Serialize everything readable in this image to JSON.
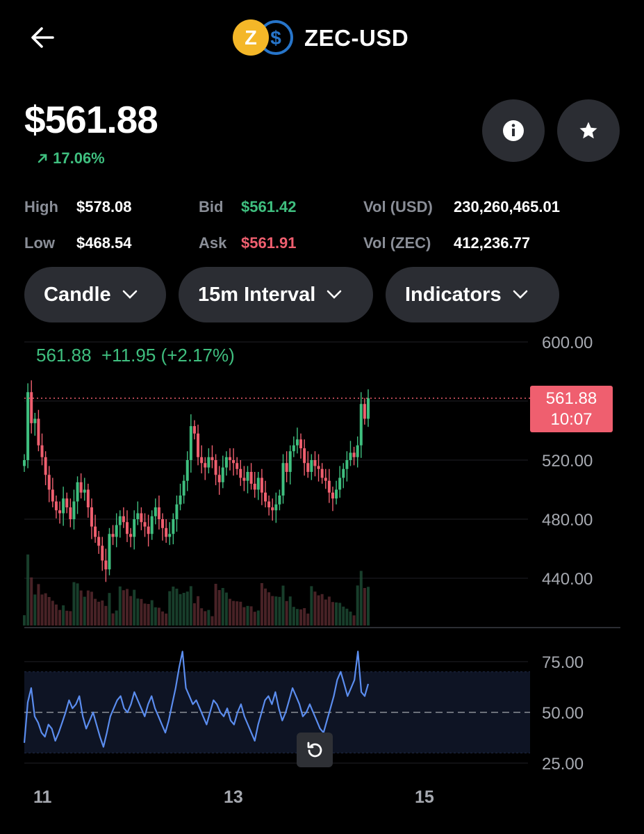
{
  "header": {
    "pair": "ZEC-USD",
    "back_icon": "arrow-left-icon",
    "base_logo_letter": "Z",
    "quote_logo_letter": "$",
    "base_logo_color": "#f4b728",
    "quote_logo_color": "#2775ca"
  },
  "price": {
    "current": "$561.88",
    "change_pct": "17.06%",
    "change_icon": "arrow-up-right-icon"
  },
  "stats": {
    "high_label": "High",
    "high_value": "$578.08",
    "low_label": "Low",
    "low_value": "$468.54",
    "bid_label": "Bid",
    "bid_value": "$561.42",
    "ask_label": "Ask",
    "ask_value": "$561.91",
    "vol_usd_label": "Vol (USD)",
    "vol_usd_value": "230,260,465.01",
    "vol_zec_label": "Vol (ZEC)",
    "vol_zec_value": "412,236.77"
  },
  "controls": {
    "chart_type": "Candle",
    "interval": "15m Interval",
    "indicators": "Indicators"
  },
  "chart": {
    "ohlc_price": "561.88",
    "ohlc_change": "+11.95",
    "ohlc_change_pct": "(+2.17%)",
    "price_tag_value": "561.88",
    "price_tag_countdown": "10:07",
    "price_ticks": [
      "600.00",
      "520.00",
      "480.00",
      "440.00"
    ],
    "rsi_ticks": [
      "75.00",
      "50.00",
      "25.00"
    ],
    "x_ticks": [
      "11",
      "13",
      "15"
    ]
  },
  "colors": {
    "up": "#3fbf7f",
    "down": "#ef5f6f",
    "rsi": "#5b8def",
    "background": "#000000",
    "button": "#2b2d33"
  },
  "chart_data": {
    "type": "candlestick",
    "ylim": [
      420,
      610
    ],
    "close_series": [
      520,
      566,
      545,
      548,
      530,
      522,
      510,
      500,
      492,
      486,
      484,
      494,
      488,
      480,
      492,
      505,
      498,
      500,
      488,
      475,
      468,
      462,
      452,
      446,
      470,
      468,
      476,
      482,
      478,
      470,
      468,
      480,
      484,
      478,
      475,
      470,
      482,
      488,
      480,
      474,
      468,
      470,
      480,
      490,
      496,
      506,
      520,
      543,
      538,
      522,
      518,
      515,
      522,
      520,
      510,
      505,
      515,
      522,
      520,
      518,
      514,
      508,
      506,
      512,
      504,
      500,
      508,
      498,
      492,
      488,
      486,
      490,
      496,
      518,
      512,
      526,
      530,
      534,
      528,
      518,
      512,
      520,
      516,
      514,
      508,
      506,
      498,
      494,
      500,
      508,
      514,
      520,
      525,
      522,
      530,
      558,
      548,
      561.88
    ],
    "rsi_ylim": [
      20,
      90
    ],
    "rsi_series": [
      35,
      55,
      62,
      48,
      45,
      40,
      38,
      44,
      42,
      36,
      40,
      45,
      50,
      56,
      52,
      54,
      58,
      48,
      42,
      46,
      50,
      44,
      38,
      33,
      40,
      48,
      52,
      56,
      58,
      52,
      50,
      54,
      60,
      56,
      52,
      48,
      54,
      58,
      52,
      48,
      44,
      40,
      46,
      54,
      62,
      72,
      80,
      62,
      58,
      54,
      56,
      52,
      48,
      44,
      50,
      56,
      54,
      50,
      48,
      52,
      46,
      44,
      50,
      54,
      48,
      44,
      40,
      36,
      44,
      50,
      56,
      58,
      54,
      60,
      52,
      46,
      50,
      56,
      62,
      58,
      54,
      48,
      50,
      54,
      50,
      46,
      42,
      40,
      46,
      52,
      58,
      66,
      70,
      64,
      58,
      62,
      66,
      80,
      60,
      58,
      64
    ]
  }
}
